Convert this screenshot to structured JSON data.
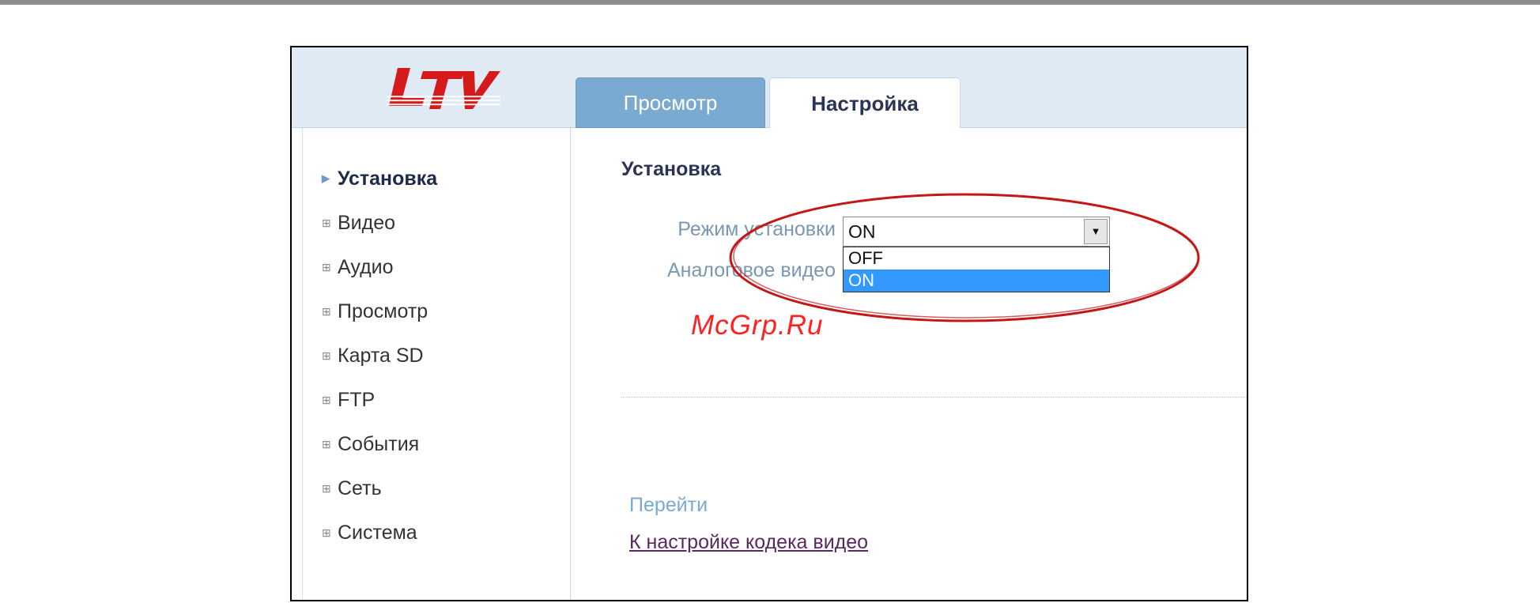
{
  "logo": {
    "text": "LTV",
    "color": "#d41a1a"
  },
  "tabs": [
    {
      "label": "Просмотр",
      "active": false
    },
    {
      "label": "Настройка",
      "active": true
    }
  ],
  "sidebar": {
    "items": [
      {
        "label": "Установка",
        "active": true,
        "marker": "arrow"
      },
      {
        "label": "Видео",
        "active": false,
        "marker": "plus-box"
      },
      {
        "label": "Аудио",
        "active": false,
        "marker": "plus-box"
      },
      {
        "label": "Просмотр",
        "active": false,
        "marker": "plus-box"
      },
      {
        "label": "Карта SD",
        "active": false,
        "marker": "plus-box"
      },
      {
        "label": "FTP",
        "active": false,
        "marker": "plus-box"
      },
      {
        "label": "События",
        "active": false,
        "marker": "plus-box"
      },
      {
        "label": "Сеть",
        "active": false,
        "marker": "plus-box"
      },
      {
        "label": "Система",
        "active": false,
        "marker": "plus-box"
      }
    ]
  },
  "main": {
    "section_title": "Установка",
    "form": {
      "mode_label": "Режим установки",
      "mode_value": "ON",
      "analog_label": "Аналоговое видео",
      "dropdown_options": [
        {
          "label": "OFF",
          "highlighted": false
        },
        {
          "label": "ON",
          "highlighted": true
        }
      ]
    },
    "goto_label": "Перейти",
    "codec_link": "К настройке кодека видео"
  },
  "watermark": "McGrp.Ru",
  "colors": {
    "accent_tab": "#7aaad0",
    "header_bg": "#dfeaf4",
    "highlight": "#3399ff",
    "annotation_ellipse": "#c41818"
  }
}
